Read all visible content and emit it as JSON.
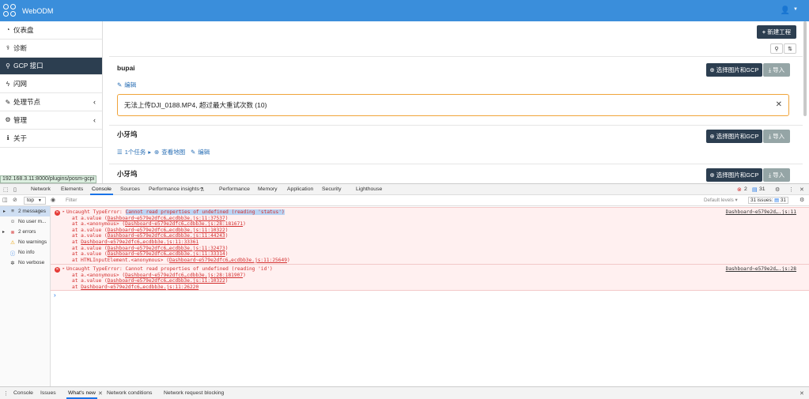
{
  "app": {
    "brand": "WebODM"
  },
  "sidebar": {
    "items": [
      {
        "icon": "dashboard-icon",
        "glyph": "◔",
        "label": "仪表盘"
      },
      {
        "icon": "stethoscope-icon",
        "glyph": "⚕",
        "label": "诊断"
      },
      {
        "icon": "map-marker-icon",
        "glyph": "⚲",
        "label": "GCP 接口"
      },
      {
        "icon": "bolt-icon",
        "glyph": "ϟ",
        "label": "闪网"
      },
      {
        "icon": "wrench-icon",
        "glyph": "✎",
        "label": "处理节点"
      },
      {
        "icon": "cogs-icon",
        "glyph": "⚙",
        "label": "管理"
      },
      {
        "icon": "info-icon",
        "glyph": "ℹ",
        "label": "关于"
      }
    ]
  },
  "header": {
    "new_project": "新建工程"
  },
  "projects": [
    {
      "name": "bupai",
      "edit": "编辑",
      "select": "选择图片和GCP",
      "import": "导入"
    },
    {
      "name": "小牙坞",
      "tasks": "1个任务",
      "view_map": "查看地图",
      "edit": "编辑",
      "select": "选择图片和GCP",
      "import": "导入"
    },
    {
      "name": "小牙坞",
      "select": "选择图片和GCP",
      "import": "导入"
    }
  ],
  "alert": {
    "text": "无法上传DJI_0188.MP4, 超过最大重试次数 (10)"
  },
  "status_url": "192.168.3.11:8000/plugins/posm-gcpi",
  "devtools": {
    "tabs": [
      "Network",
      "Elements",
      "Console",
      "Sources",
      "Performance insights",
      "Performance",
      "Memory",
      "Application",
      "Security",
      "Lighthouse"
    ],
    "errors_count": "2",
    "messages_count": "31",
    "context": "top",
    "filter_placeholder": "Filter",
    "default_levels": "Default levels",
    "issues_label": "31 issues:",
    "issues_count": "31",
    "sidebar": [
      {
        "label": "2 messages",
        "glyph": "≡"
      },
      {
        "label": "No user m...",
        "glyph": "☺"
      },
      {
        "label": "2 errors",
        "glyph": "⊗"
      },
      {
        "label": "No warnings",
        "glyph": "⚠"
      },
      {
        "label": "No info",
        "glyph": "ⓘ"
      },
      {
        "label": "No verbose",
        "glyph": "✲"
      }
    ],
    "log1": {
      "prefix": "Uncaught TypeError: ",
      "message": "Cannot read properties of undefined (reading 'status')",
      "source": "Dashboard~e579e2d….js:11",
      "frames": [
        {
          "fn": "at a.value (",
          "loc": "Dashboard~e579e2dfc6…ecdbb3e.js:11:37537",
          "end": ")"
        },
        {
          "fn": "at a.<anonymous> (",
          "loc": "Dashboard~e579e2dfc6…cdbb3e.js:28:181671",
          "end": ")"
        },
        {
          "fn": "at a.value (",
          "loc": "Dashboard~e579e2dfc6…ecdbb3e.js:11:10322",
          "end": ")"
        },
        {
          "fn": "at a.value (",
          "loc": "Dashboard~e579e2dfc6…ecdbb3e.js:11:44243",
          "end": ")"
        },
        {
          "fn": "at ",
          "loc": "Dashboard~e579e2dfc6…ecdbb3e.js:11:33361",
          "end": ""
        },
        {
          "fn": "at a.value (",
          "loc": "Dashboard~e579e2dfc6…ecdbb3e.js:11:32473",
          "end": ")"
        },
        {
          "fn": "at a.value (",
          "loc": "Dashboard~e579e2dfc6…ecdbb3e.js:11:33314",
          "end": ")"
        },
        {
          "fn": "at HTMLInputElement.<anonymous> (",
          "loc": "Dashboard~e579e2dfc6…ecdbb3e.js:11:25649",
          "end": ")"
        }
      ]
    },
    "log2": {
      "message": "Uncaught TypeError: Cannot read properties of undefined (reading 'id')",
      "source": "Dashboard~e579e2d….js:28",
      "frames": [
        {
          "fn": "at a.<anonymous> (",
          "loc": "Dashboard~e579e2dfc6…cdbb3e.js:28:181907",
          "end": ")"
        },
        {
          "fn": "at a.value (",
          "loc": "Dashboard~e579e2dfc6…ecdbb3e.js:11:10322",
          "end": ")"
        },
        {
          "fn": "at ",
          "loc": "Dashboard~e579e2dfc6…ecdbb3e.js:11:26220",
          "end": ""
        }
      ]
    },
    "drawer_tabs": [
      "Console",
      "Issues",
      "What's new",
      "Network conditions",
      "Network request blocking"
    ]
  }
}
